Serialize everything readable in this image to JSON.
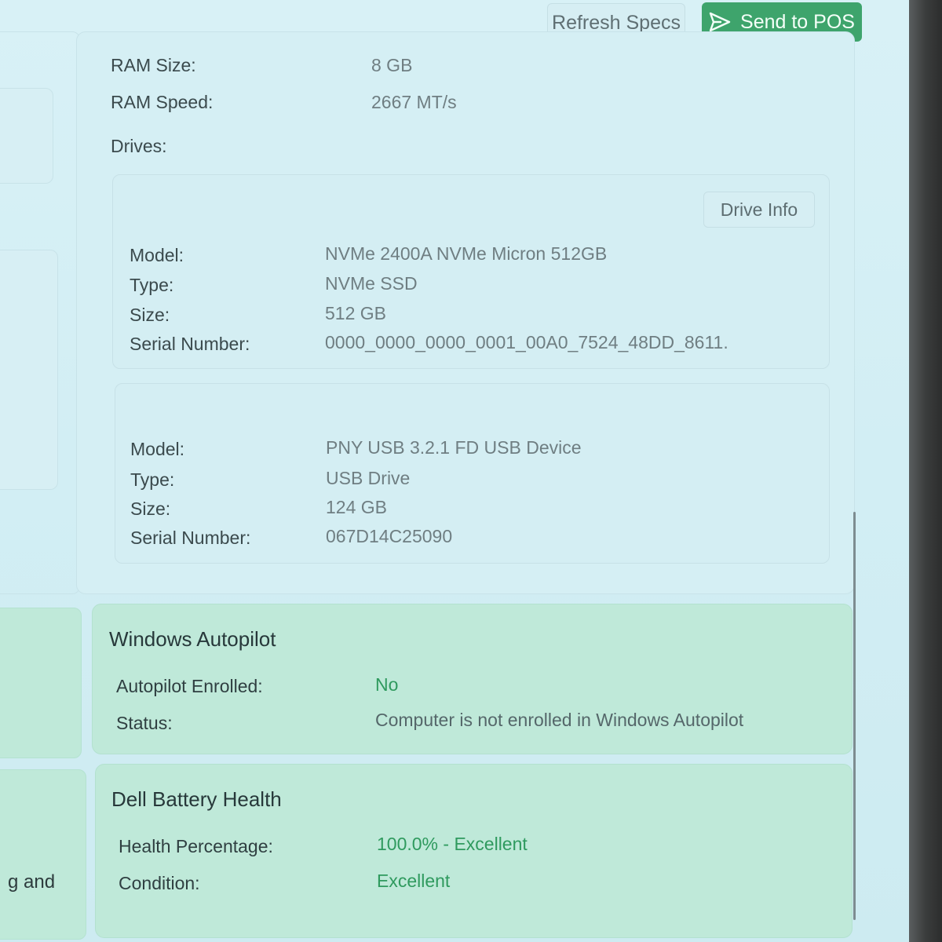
{
  "toolbar": {
    "refresh_label": "Refresh Specs",
    "send_label": "Send to POS",
    "send_icon": "send-icon"
  },
  "specs": {
    "ram_size_label": "RAM Size:",
    "ram_size_value": "8 GB",
    "ram_speed_label": "RAM Speed:",
    "ram_speed_value": "2667 MT/s",
    "drives_label": "Drives:",
    "drive_info_label": "Drive Info",
    "drives": [
      {
        "model_label": "Model:",
        "model": "NVMe 2400A NVMe Micron 512GB",
        "type_label": "Type:",
        "type": "NVMe SSD",
        "size_label": "Size:",
        "size": "512 GB",
        "serial_label": "Serial Number:",
        "serial": "0000_0000_0000_0001_00A0_7524_48DD_8611."
      },
      {
        "model_label": "Model:",
        "model": "PNY USB 3.2.1 FD USB Device",
        "type_label": "Type:",
        "type": "USB Drive",
        "size_label": "Size:",
        "size": "124 GB",
        "serial_label": "Serial Number:",
        "serial": "067D14C25090"
      }
    ]
  },
  "autopilot": {
    "title": "Windows Autopilot",
    "enrolled_label": "Autopilot Enrolled:",
    "enrolled_value": "No",
    "status_label": "Status:",
    "status_value": "Computer is not enrolled in Windows Autopilot"
  },
  "battery": {
    "title": "Dell Battery Health",
    "health_label": "Health Percentage:",
    "health_value": "100.0% - Excellent",
    "condition_label": "Condition:",
    "condition_value": "Excellent"
  },
  "left_partial_text": "g and",
  "colors": {
    "accent_green": "#3ea46c",
    "card_green": "#bfe9d9",
    "status_green": "#2f9a5e"
  }
}
